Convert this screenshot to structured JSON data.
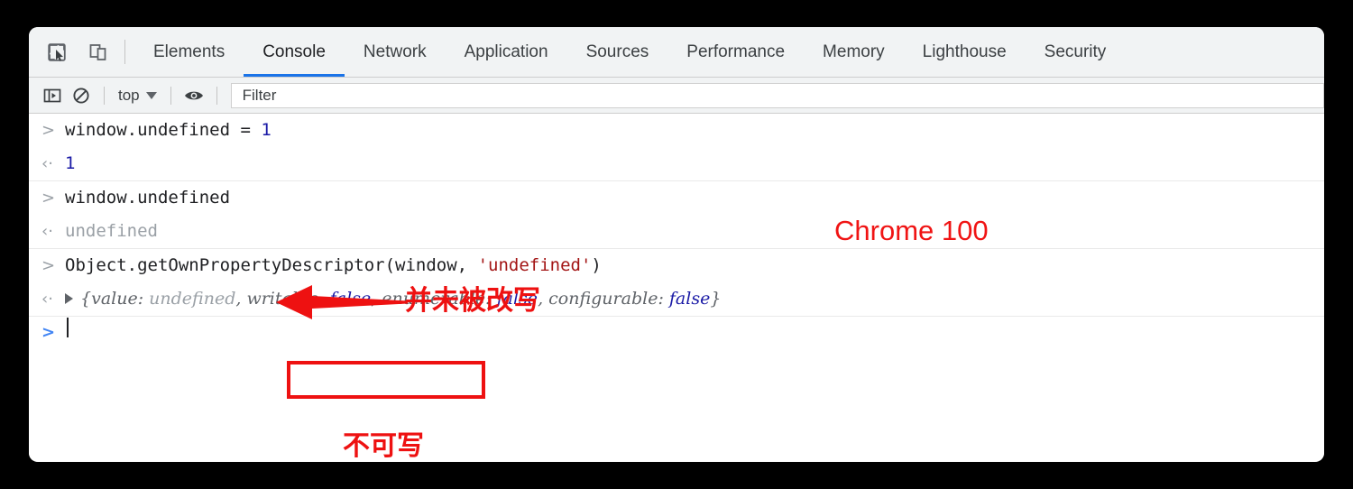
{
  "window": {
    "tabs": [
      {
        "label": "Elements",
        "active": false
      },
      {
        "label": "Console",
        "active": true
      },
      {
        "label": "Network",
        "active": false
      },
      {
        "label": "Application",
        "active": false
      },
      {
        "label": "Sources",
        "active": false
      },
      {
        "label": "Performance",
        "active": false
      },
      {
        "label": "Memory",
        "active": false
      },
      {
        "label": "Lighthouse",
        "active": false
      },
      {
        "label": "Security",
        "active": false
      }
    ],
    "tool_icons": [
      {
        "name": "inspect-element-icon"
      },
      {
        "name": "device-toolbar-icon"
      }
    ]
  },
  "toolbar": {
    "sidebar_toggle": "console-sidebar-icon",
    "clear_console": "clear-console-icon",
    "context": "top",
    "eye_icon": "live-expression-eye-icon",
    "filter_placeholder": "Filter",
    "filter_value": ""
  },
  "console": {
    "entries": [
      {
        "input_prefix": ">",
        "input_code": "window.undefined = ",
        "input_number": "1",
        "output_prefix": "‹·",
        "output_value": "1"
      },
      {
        "input_prefix": ">",
        "input_code": "window.undefined",
        "output_prefix": "‹·",
        "output_value": "undefined"
      },
      {
        "input_prefix": ">",
        "input_code": "Object.getOwnPropertyDescriptor(window, ",
        "input_string": "'undefined'",
        "input_code_tail": ")",
        "output_prefix": "‹·",
        "descriptor": {
          "open": "{",
          "value_key": "value: ",
          "value_val": "undefined",
          "sep1": ", ",
          "writable_key": "writable: ",
          "writable_val": "false",
          "sep2": ", ",
          "enumerable_key": "enumerable: ",
          "enumerable_val": "false",
          "sep3": ", ",
          "configurable_key": "configurable: ",
          "configurable_val": "false",
          "close": "}"
        }
      }
    ],
    "prompt_prefix": ">",
    "prompt_value": ""
  },
  "annotations": {
    "chrome_version": "Chrome 100",
    "not_rewritten": "并未被改写",
    "not_writable": "不可写",
    "arrow_color": "#ee1111",
    "highlight_box_color": "#ee1111"
  }
}
